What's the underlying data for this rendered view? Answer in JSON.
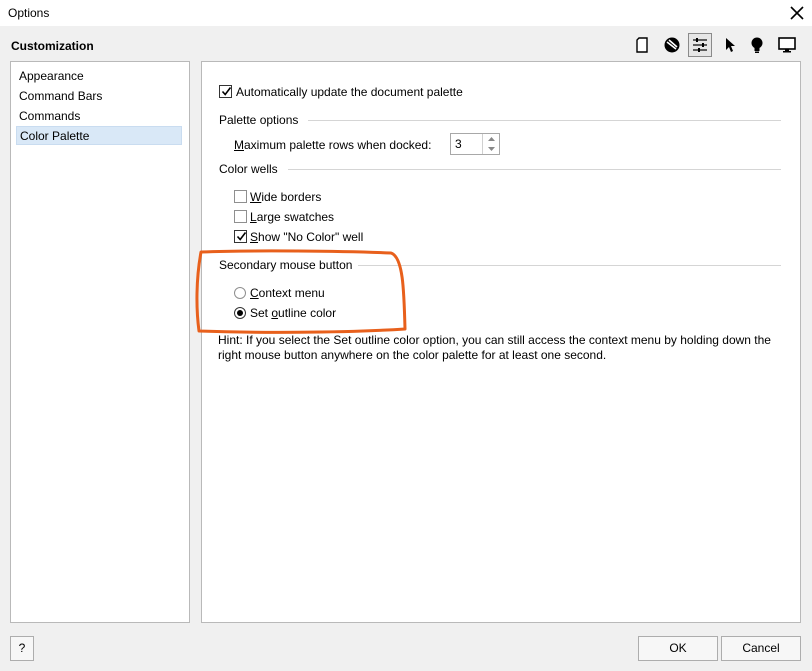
{
  "window": {
    "title": "Options"
  },
  "section": {
    "title": "Customization"
  },
  "toolbar": {
    "icons": [
      "document-icon",
      "globe-icon",
      "sliders-icon",
      "cursor-icon",
      "lightbulb-icon",
      "monitor-icon"
    ],
    "active": "sliders-icon"
  },
  "tree": {
    "items": [
      {
        "label": "Appearance"
      },
      {
        "label": "Command Bars"
      },
      {
        "label": "Commands"
      },
      {
        "label": "Color Palette"
      }
    ],
    "selected": "Color Palette"
  },
  "panel": {
    "auto_update": {
      "label": "Automatically update the document palette",
      "checked": true
    },
    "palette_options": {
      "title": "Palette options",
      "max_rows": {
        "label_underlined": "M",
        "label_rest": "aximum palette rows when docked:",
        "value": "3"
      }
    },
    "color_wells": {
      "title": "Color wells",
      "wide_borders": {
        "label_underlined": "W",
        "label_rest": "ide borders",
        "checked": false
      },
      "large_swatches": {
        "label_underlined": "L",
        "label_rest": "arge swatches",
        "checked": false
      },
      "show_no_color": {
        "label_underlined": "S",
        "label_rest": "how \"No Color\" well",
        "checked": true
      }
    },
    "secondary_mouse": {
      "title": "Secondary mouse button",
      "context_menu": {
        "label_underlined": "C",
        "label_rest": "ontext menu",
        "selected": false
      },
      "set_outline": {
        "label_pre": "Set ",
        "label_underlined": "o",
        "label_rest": "utline color",
        "selected": true
      }
    },
    "hint": "Hint: If you select the Set outline color option, you can still access the context menu by holding down the right mouse button anywhere on the color palette for at least one second."
  },
  "footer": {
    "help": "?",
    "ok": "OK",
    "cancel": "Cancel"
  },
  "colors": {
    "highlight": "#e8601c",
    "selection": "#d9e8f7"
  }
}
